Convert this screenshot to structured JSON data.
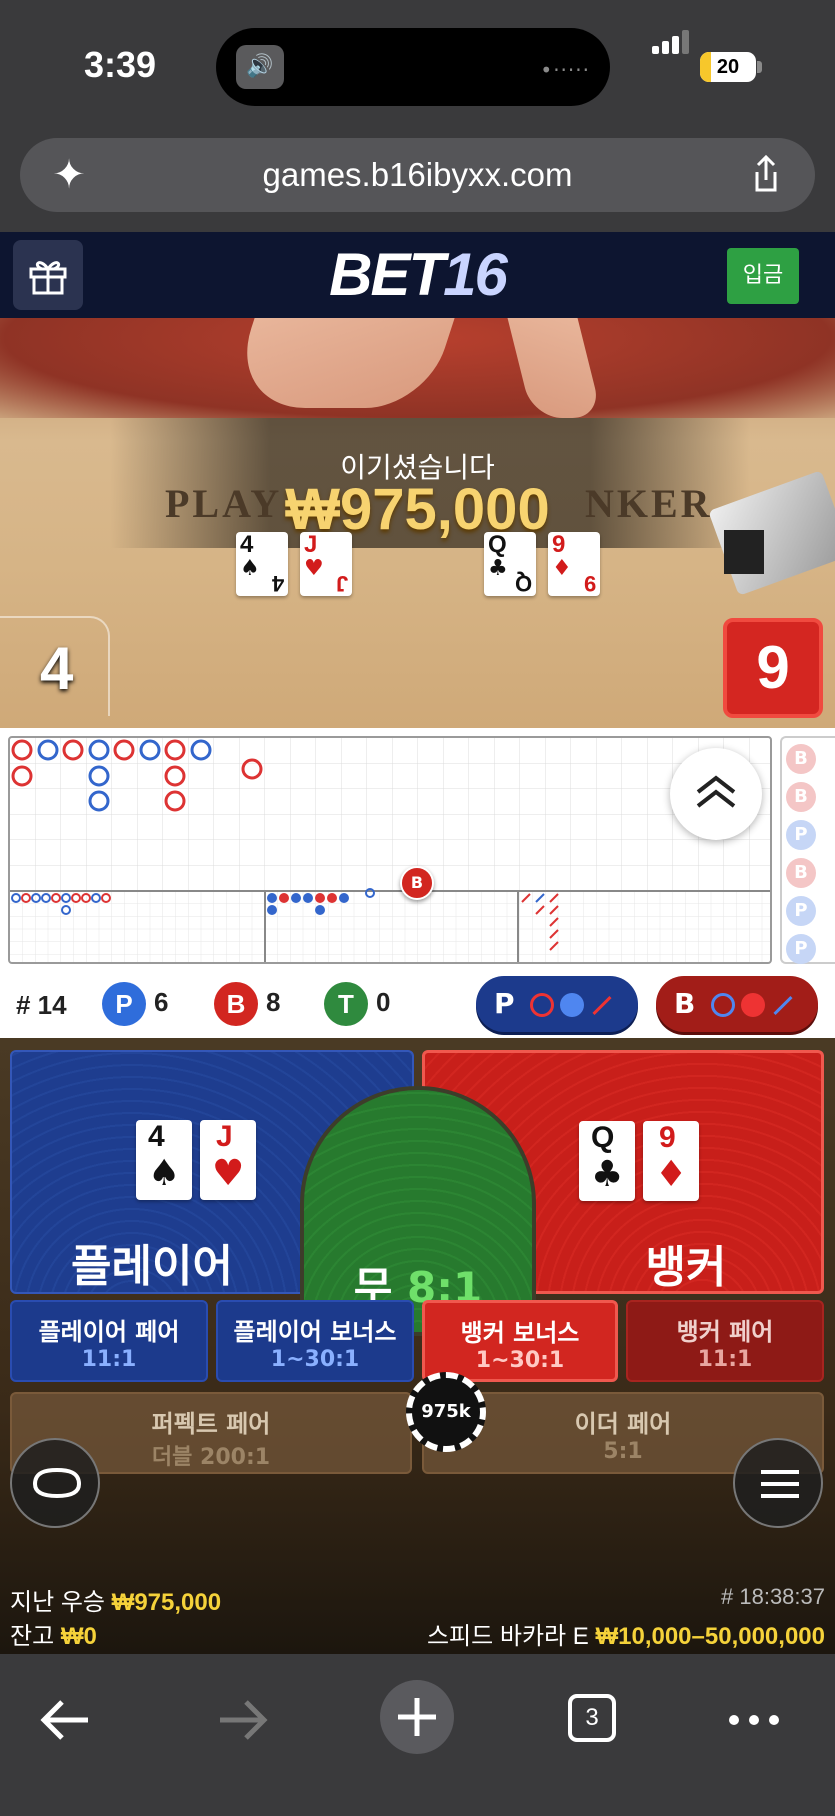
{
  "status": {
    "time": "3:39",
    "battery": "20",
    "battery_level": 0.2
  },
  "browser": {
    "url": "games.b16ibyxx.com",
    "tabs_count": "3"
  },
  "header": {
    "logo_a": "BET",
    "logo_b": "16",
    "deposit": "입금"
  },
  "video": {
    "win_title": "이기셨습니다",
    "win_amount": "₩975,000",
    "felt_left": "PLAY",
    "felt_right": "NKER",
    "player_cards": [
      {
        "rank": "4",
        "suit": "♠",
        "color": "black"
      },
      {
        "rank": "J",
        "suit": "♥",
        "color": "red"
      }
    ],
    "banker_cards": [
      {
        "rank": "Q",
        "suit": "♣",
        "color": "black"
      },
      {
        "rank": "9",
        "suit": "♦",
        "color": "red"
      }
    ],
    "player_score": "4",
    "banker_score": "9"
  },
  "roadmap": {
    "marker": "B",
    "side_column": [
      "B",
      "B",
      "P",
      "B",
      "P",
      "P"
    ]
  },
  "stats": {
    "round_label": "# 14",
    "player_badge": "P",
    "player_count": "6",
    "banker_badge": "B",
    "banker_count": "8",
    "tie_badge": "T",
    "tie_count": "0",
    "predict_player": "P",
    "predict_banker": "B"
  },
  "bet": {
    "player_label": "플레이어",
    "tie_label": "무",
    "tie_odds": "8:1",
    "banker_label": "뱅커",
    "side_bets": [
      {
        "title": "플레이어 페어",
        "odds": "11:1"
      },
      {
        "title": "플레이어 보너스",
        "odds": "1~30:1"
      },
      {
        "title": "뱅커 보너스",
        "odds": "1~30:1"
      },
      {
        "title": "뱅커 페어",
        "odds": "11:1"
      }
    ],
    "perfect_pair": {
      "title": "퍼펙트 페어",
      "odds": "더블 200:1"
    },
    "either_pair": {
      "title": "이더 페어",
      "odds": "5:1"
    },
    "chip": "975k"
  },
  "footer": {
    "last_win_label": "지난 우승",
    "last_win_amount": "₩975,000",
    "balance_label": "잔고",
    "balance_amount": "₩0",
    "round_time": "# 18:38:37",
    "table_name": "스피드 바카라 E",
    "limits": "₩10,000–50,000,000"
  },
  "colors": {
    "player": "#234599",
    "banker": "#d22620",
    "tie": "#2c8533",
    "gold": "#f5d23a",
    "deposit": "#2ea043"
  }
}
